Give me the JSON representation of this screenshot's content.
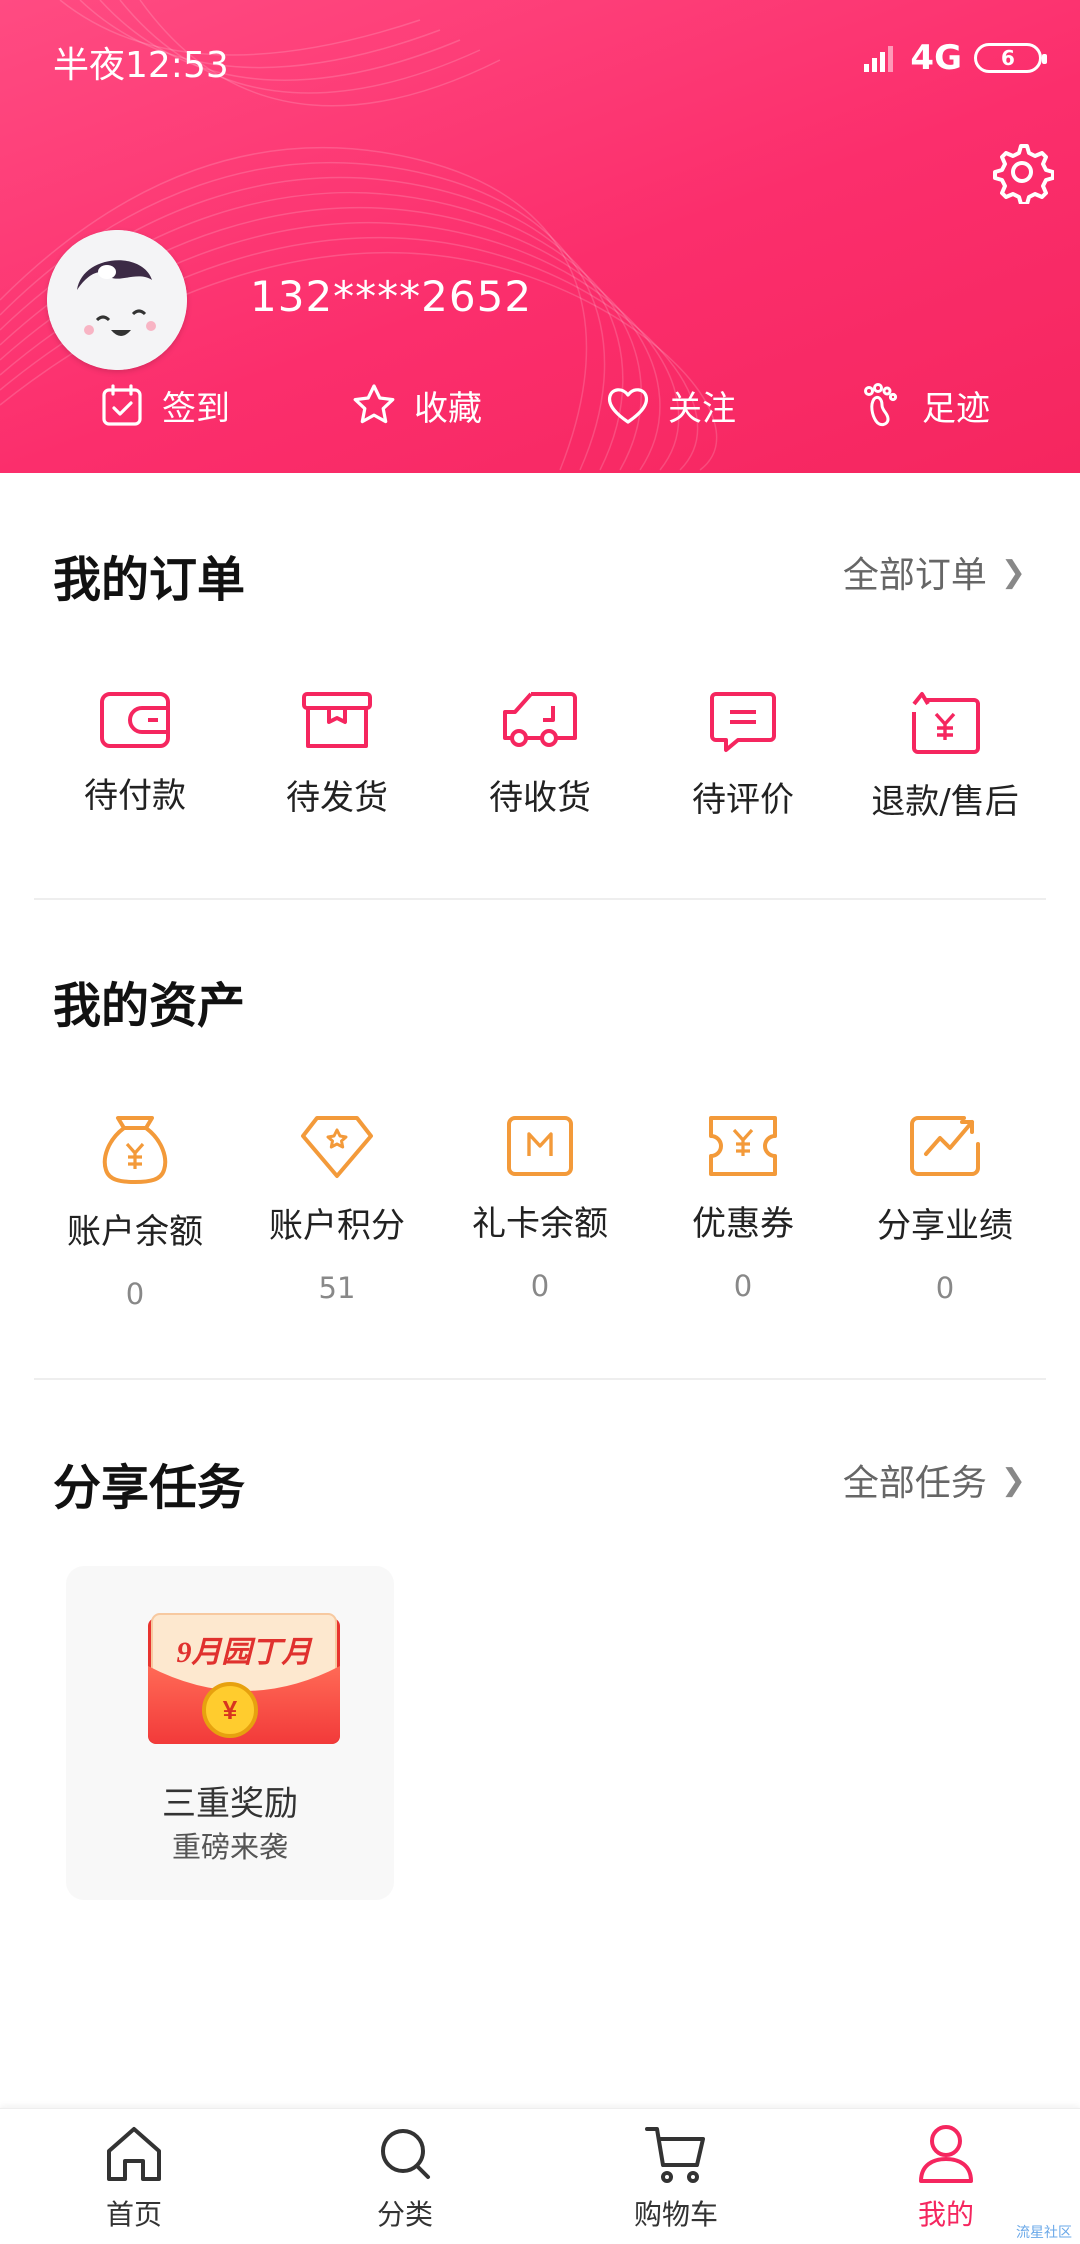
{
  "status_bar": {
    "time": "半夜12:53",
    "network": "4G",
    "battery": "6"
  },
  "profile": {
    "phone": "132****2652"
  },
  "quick_actions": [
    {
      "label": "签到",
      "icon": "calendar-check-icon"
    },
    {
      "label": "收藏",
      "icon": "star-icon"
    },
    {
      "label": "关注",
      "icon": "heart-icon"
    },
    {
      "label": "足迹",
      "icon": "footprint-icon"
    }
  ],
  "orders": {
    "title": "我的订单",
    "more": "全部订单",
    "items": [
      {
        "label": "待付款",
        "icon": "wallet-icon"
      },
      {
        "label": "待发货",
        "icon": "box-icon"
      },
      {
        "label": "待收货",
        "icon": "truck-icon"
      },
      {
        "label": "待评价",
        "icon": "comment-icon"
      },
      {
        "label": "退款/售后",
        "icon": "refund-icon"
      }
    ]
  },
  "assets": {
    "title": "我的资产",
    "items": [
      {
        "label": "账户余额",
        "value": "0",
        "icon": "money-bag-icon"
      },
      {
        "label": "账户积分",
        "value": "51",
        "icon": "diamond-icon"
      },
      {
        "label": "礼卡余额",
        "value": "0",
        "icon": "gift-card-icon"
      },
      {
        "label": "优惠券",
        "value": "0",
        "icon": "coupon-icon"
      },
      {
        "label": "分享业绩",
        "value": "0",
        "icon": "chart-icon"
      }
    ]
  },
  "tasks": {
    "title": "分享任务",
    "more": "全部任务",
    "card": {
      "banner": "9月园丁月",
      "title": "三重奖励",
      "subtitle": "重磅来袭"
    }
  },
  "bottom_nav": [
    {
      "label": "首页",
      "icon": "home-icon"
    },
    {
      "label": "分类",
      "icon": "search-icon"
    },
    {
      "label": "购物车",
      "icon": "cart-icon"
    },
    {
      "label": "我的",
      "icon": "user-icon",
      "active": true
    }
  ],
  "watermark": "流星社区",
  "colors": {
    "brand": "#f5265f",
    "asset_icon": "#f39a3a"
  }
}
